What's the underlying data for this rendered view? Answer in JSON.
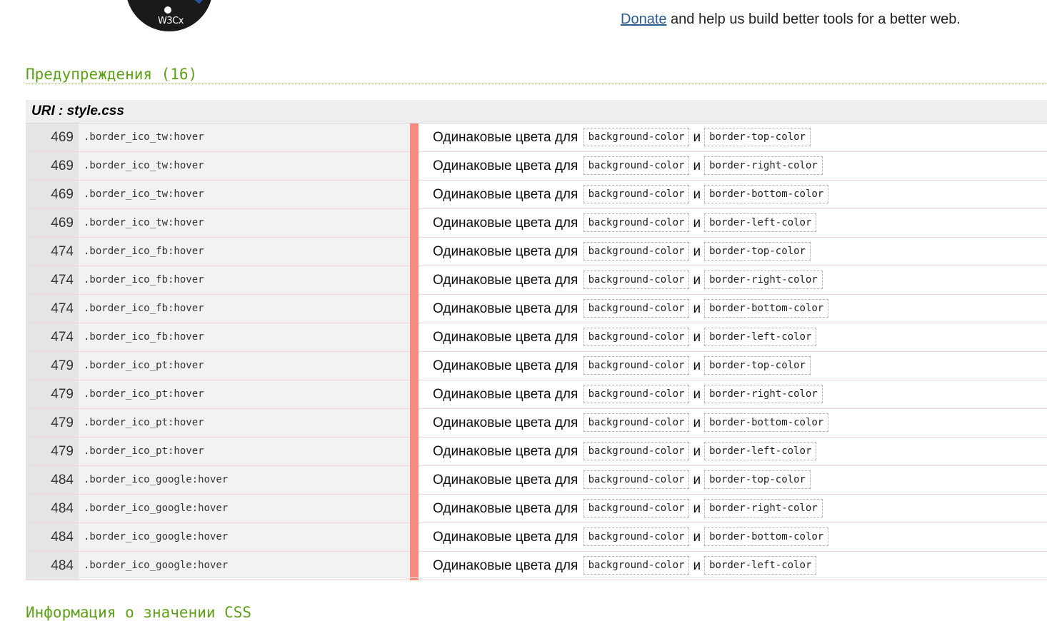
{
  "header": {
    "logo_text": "W3Cx",
    "donate_link": "Donate",
    "donate_text": " and help us build better tools for a better web."
  },
  "warnings": {
    "title": "Предупреждения (16)",
    "uri_label": "URI : style.css",
    "message_prefix": "Одинаковые цвета для",
    "conjunction": "и",
    "rows": [
      {
        "line": "469",
        "selector": ".border_ico_tw:hover",
        "prop1": "background-color",
        "prop2": "border-top-color"
      },
      {
        "line": "469",
        "selector": ".border_ico_tw:hover",
        "prop1": "background-color",
        "prop2": "border-right-color"
      },
      {
        "line": "469",
        "selector": ".border_ico_tw:hover",
        "prop1": "background-color",
        "prop2": "border-bottom-color"
      },
      {
        "line": "469",
        "selector": ".border_ico_tw:hover",
        "prop1": "background-color",
        "prop2": "border-left-color"
      },
      {
        "line": "474",
        "selector": ".border_ico_fb:hover",
        "prop1": "background-color",
        "prop2": "border-top-color"
      },
      {
        "line": "474",
        "selector": ".border_ico_fb:hover",
        "prop1": "background-color",
        "prop2": "border-right-color"
      },
      {
        "line": "474",
        "selector": ".border_ico_fb:hover",
        "prop1": "background-color",
        "prop2": "border-bottom-color"
      },
      {
        "line": "474",
        "selector": ".border_ico_fb:hover",
        "prop1": "background-color",
        "prop2": "border-left-color"
      },
      {
        "line": "479",
        "selector": ".border_ico_pt:hover",
        "prop1": "background-color",
        "prop2": "border-top-color"
      },
      {
        "line": "479",
        "selector": ".border_ico_pt:hover",
        "prop1": "background-color",
        "prop2": "border-right-color"
      },
      {
        "line": "479",
        "selector": ".border_ico_pt:hover",
        "prop1": "background-color",
        "prop2": "border-bottom-color"
      },
      {
        "line": "479",
        "selector": ".border_ico_pt:hover",
        "prop1": "background-color",
        "prop2": "border-left-color"
      },
      {
        "line": "484",
        "selector": ".border_ico_google:hover",
        "prop1": "background-color",
        "prop2": "border-top-color"
      },
      {
        "line": "484",
        "selector": ".border_ico_google:hover",
        "prop1": "background-color",
        "prop2": "border-right-color"
      },
      {
        "line": "484",
        "selector": ".border_ico_google:hover",
        "prop1": "background-color",
        "prop2": "border-bottom-color"
      },
      {
        "line": "484",
        "selector": ".border_ico_google:hover",
        "prop1": "background-color",
        "prop2": "border-left-color"
      }
    ]
  },
  "next_section": {
    "title": "Информация о значении CSS"
  },
  "colors": {
    "section_title": "#5fa01a",
    "warning_bar": "#f78b80",
    "link": "#2b5d8f"
  }
}
